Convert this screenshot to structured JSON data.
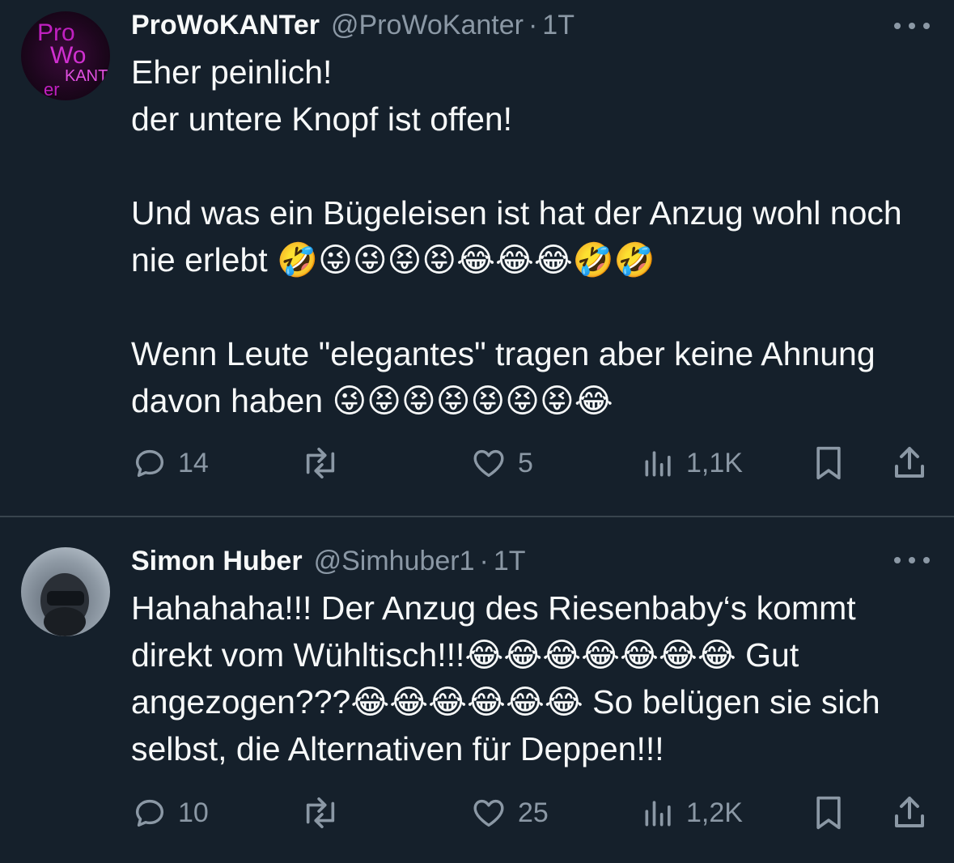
{
  "tweets": [
    {
      "name": "ProWoKANTer",
      "handle": "@ProWoKanter",
      "separator": "·",
      "time": "1T",
      "avatar_text": "Pro Wo KANT er",
      "text": "Eher peinlich!\n der untere Knopf ist offen!\n\nUnd was ein Bügeleisen ist hat der Anzug wohl noch nie erlebt 🤣😜😜😝😝😂😂😂🤣🤣\n\nWenn Leute \"elegantes\" tragen aber keine Ahnung davon haben 😜😝😝😝😝😝😝😂",
      "replies": "14",
      "likes": "5",
      "views": "1,1K"
    },
    {
      "name": "Simon Huber",
      "handle": "@Simhuber1",
      "separator": "·",
      "time": "1T",
      "text": "Hahahaha!!! Der Anzug des Riesenbaby‘s kommt direkt vom Wühltisch!!!😂😂😂😂😂😂😂 Gut angezogen???😂😂😂😂😂😂 So belügen sie sich selbst, die Alternativen für Deppen!!!",
      "replies": "10",
      "likes": "25",
      "views": "1,2K"
    }
  ],
  "icons": {
    "more": "more-dots-icon",
    "reply": "reply-bubble-icon",
    "retweet": "retweet-icon",
    "like": "heart-icon",
    "views": "views-bars-icon",
    "bookmark": "bookmark-icon",
    "share": "share-upload-icon"
  },
  "colors": {
    "background": "#15202b",
    "text": "#f7f9f9",
    "secondary": "#8b98a5",
    "divider": "#38444d"
  }
}
